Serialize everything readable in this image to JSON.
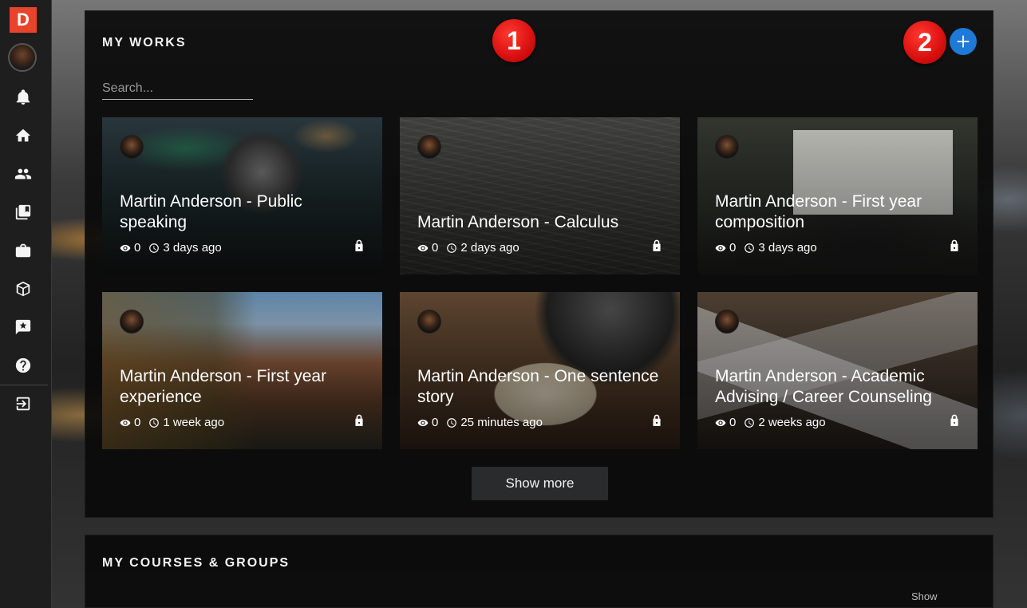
{
  "sidebar": {
    "logo": "D",
    "items": [
      {
        "name": "notifications",
        "icon": "bell-icon"
      },
      {
        "name": "home",
        "icon": "home-icon"
      },
      {
        "name": "people",
        "icon": "people-icon"
      },
      {
        "name": "library",
        "icon": "book-icon"
      },
      {
        "name": "portfolio",
        "icon": "briefcase-icon"
      },
      {
        "name": "courses",
        "icon": "box-icon"
      },
      {
        "name": "feedback",
        "icon": "star-box-icon"
      },
      {
        "name": "help",
        "icon": "question-icon"
      },
      {
        "name": "logout",
        "icon": "exit-icon"
      }
    ]
  },
  "works": {
    "title": "MY WORKS",
    "search_placeholder": "Search...",
    "badge_1": "1",
    "badge_2": "2",
    "add_icon": "plus-icon",
    "cards": [
      {
        "title": "Martin Anderson - Public speaking",
        "views": "0",
        "time": "3 days ago"
      },
      {
        "title": "Martin Anderson - Calculus",
        "views": "0",
        "time": "2 days ago"
      },
      {
        "title": "Martin Anderson - First year composition",
        "views": "0",
        "time": "3 days ago"
      },
      {
        "title": "Martin Anderson - First year experience",
        "views": "0",
        "time": "1 week ago"
      },
      {
        "title": "Martin Anderson - One sentence story",
        "views": "0",
        "time": "25 minutes ago"
      },
      {
        "title": "Martin Anderson - Academic Advising / Career Counseling",
        "views": "0",
        "time": "2 weeks ago"
      }
    ],
    "show_more": "Show more"
  },
  "courses": {
    "title": "MY COURSES & GROUPS",
    "show": "Show"
  },
  "colors": {
    "logo": "#e8442c",
    "badge": "#d80f0f",
    "add_button": "#1e7ad6"
  }
}
